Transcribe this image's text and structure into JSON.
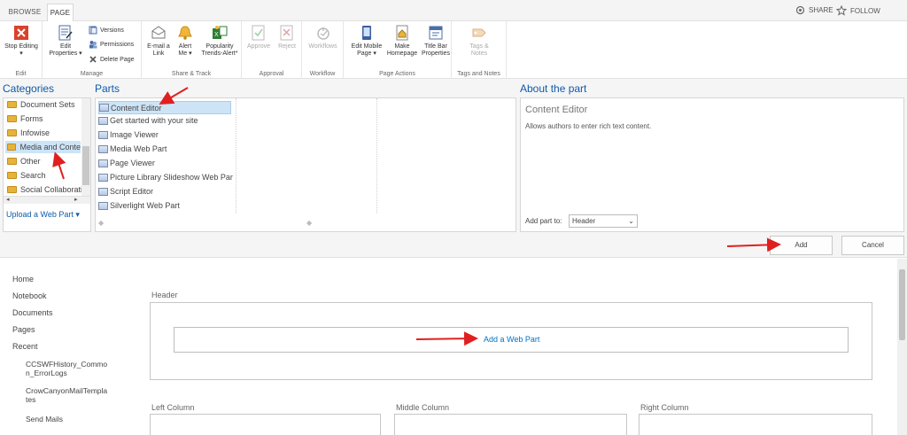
{
  "tabs": [
    {
      "label": "BROWSE",
      "active": false
    },
    {
      "label": "PAGE",
      "active": true
    }
  ],
  "topbar": {
    "share_label": "SHARE",
    "follow_label": "FOLLOW"
  },
  "ribbon": {
    "groups": {
      "edit": "Edit",
      "manage": "Manage",
      "share_track": "Share & Track",
      "approval": "Approval",
      "workflow": "Workflow",
      "page_actions": "Page Actions",
      "tags_notes": "Tags and Notes"
    },
    "buttons": {
      "stop_editing": "Stop Editing",
      "edit_properties_1": "Edit",
      "edit_properties_2": "Properties",
      "versions": "Versions",
      "permissions": "Permissions",
      "delete_page": "Delete Page",
      "email_link_1": "E-mail a",
      "email_link_2": "Link",
      "alert_me_1": "Alert",
      "alert_me_2": "Me",
      "popularity_1": "Popularity",
      "popularity_2": "Trends-Alert*",
      "approve": "Approve",
      "reject": "Reject",
      "workflows": "Workflows",
      "edit_mobile_1": "Edit Mobile",
      "edit_mobile_2": "Page",
      "make_homepage_1": "Make",
      "make_homepage_2": "Homepage",
      "title_bar_1": "Title Bar",
      "title_bar_2": "Properties",
      "tags_notes_1": "Tags &",
      "tags_notes_2": "Notes"
    }
  },
  "adder": {
    "categories_title": "Categories",
    "parts_title": "Parts",
    "about_title": "About the part",
    "categories": [
      "Document Sets",
      "Forms",
      "Infowise",
      "Media and Conte",
      "Other",
      "Search",
      "Social Collaborati"
    ],
    "selected_category": "Media and Conte",
    "upload_label": "Upload a Web Part",
    "parts": [
      "Content Editor",
      "Get started with your site",
      "Image Viewer",
      "Media Web Part",
      "Page Viewer",
      "Picture Library Slideshow Web Par",
      "Script Editor",
      "Silverlight Web Part"
    ],
    "selected_part": "Content Editor",
    "about_name": "Content Editor",
    "about_desc": "Allows authors to enter rich text content.",
    "add_part_to_label": "Add part to:",
    "add_part_to_value": "Header",
    "add_button": "Add",
    "cancel_button": "Cancel"
  },
  "leftnav": {
    "items": [
      "Home",
      "Notebook",
      "Documents",
      "Pages",
      "Recent"
    ],
    "recent": [
      "CCSWFHistory_Commo",
      "n_ErrorLogs",
      "CrowCanyonMailTempla",
      "tes",
      "Send Mails"
    ]
  },
  "zones": {
    "header": "Header",
    "add_web_part": "Add a Web Part",
    "left": "Left Column",
    "middle": "Middle Column",
    "right": "Right Column"
  },
  "colors": {
    "accent": "#0f5aa8",
    "link": "#0072c6",
    "arrow": "#e02020"
  }
}
